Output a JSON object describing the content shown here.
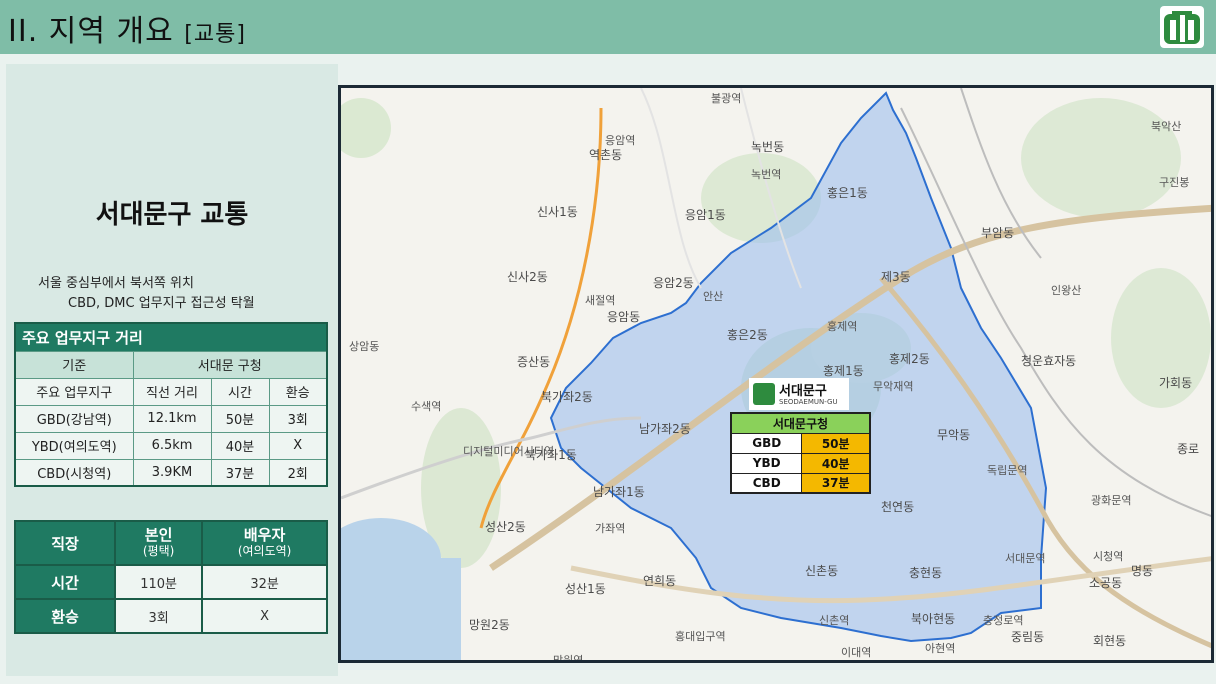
{
  "header": {
    "title": "II. 지역 개요",
    "subtitle": "[교통]"
  },
  "left": {
    "title": "서대문구 교통",
    "desc_line1": "서울 중심부에서 북서쪽 위치",
    "desc_line2": "CBD, DMC 업무지구 접근성 탁월",
    "distance_table": {
      "caption": "주요 업무지구 거리",
      "col_basis": "기준",
      "col_origin": "서대문 구청",
      "col_district": "주요 업무지구",
      "col_distance": "직선 거리",
      "col_time": "시간",
      "col_transfer": "환승",
      "rows": [
        {
          "district": "GBD(강남역)",
          "distance": "12.1km",
          "time": "50분",
          "transfer": "3회"
        },
        {
          "district": "YBD(여의도역)",
          "distance": "6.5km",
          "time": "40분",
          "transfer": "X"
        },
        {
          "district": "CBD(시청역)",
          "distance": "3.9KM",
          "time": "37분",
          "transfer": "2회"
        }
      ]
    },
    "commute_table": {
      "corner": "직장",
      "self_label": "본인",
      "self_sub": "(평택)",
      "spouse_label": "배우자",
      "spouse_sub": "(여의도역)",
      "time_label": "시간",
      "time_self": "110분",
      "time_spouse": "32분",
      "transfer_label": "환승",
      "transfer_self": "3회",
      "transfer_spouse": "X"
    }
  },
  "map": {
    "logo_name": "서대문구",
    "logo_en": "SEODAEMUN-GU",
    "box_caption": "서대문구청",
    "box_rows": [
      {
        "key": "GBD",
        "value": "50분"
      },
      {
        "key": "YBD",
        "value": "40분"
      },
      {
        "key": "CBD",
        "value": "37분"
      }
    ],
    "labels": {
      "l01": "녹번동",
      "l02": "역촌동",
      "l03": "신사1동",
      "l04": "응암1동",
      "l05": "홍은1동",
      "l06": "신사2동",
      "l07": "응암2동",
      "l08": "제3동",
      "l09": "부암동",
      "l10": "증산동",
      "l11": "홍은2동",
      "l12": "홍제1동",
      "l13": "홍제2동",
      "l14": "청운효자동",
      "l15": "북가좌2동",
      "l16": "남가좌2동",
      "l17": "무악동",
      "l18": "가회동",
      "l19": "북가좌1동",
      "l20": "남가좌1동",
      "l21": "성산2동",
      "l22": "신촌동",
      "l23": "충현동",
      "l24": "성산1동",
      "l25": "연희동",
      "l26": "망원2동",
      "l27": "북아현동",
      "l28": "중림동",
      "l29": "천연동",
      "l30": "응암동",
      "l31": "수색역",
      "l32": "디지털미디어시티역",
      "l33": "새절역",
      "l34": "홍제역",
      "l35": "무악재역",
      "l36": "녹번역",
      "l37": "독립문역",
      "l38": "서대문역",
      "l39": "신촌역",
      "l40": "이대역",
      "l41": "아현역",
      "l42": "가좌역",
      "l43": "홍대입구역",
      "l44": "충정로역",
      "l45": "광화문역",
      "l46": "종로",
      "l47": "소공동",
      "l48": "회현동",
      "l49": "명동",
      "l50": "불광역",
      "l51": "안산",
      "l52": "인왕산",
      "l53": "망원역",
      "l54": "시청역",
      "l55": "응암역",
      "l56": "상암동",
      "l57": "북악산",
      "l58": "구진봉"
    }
  }
}
